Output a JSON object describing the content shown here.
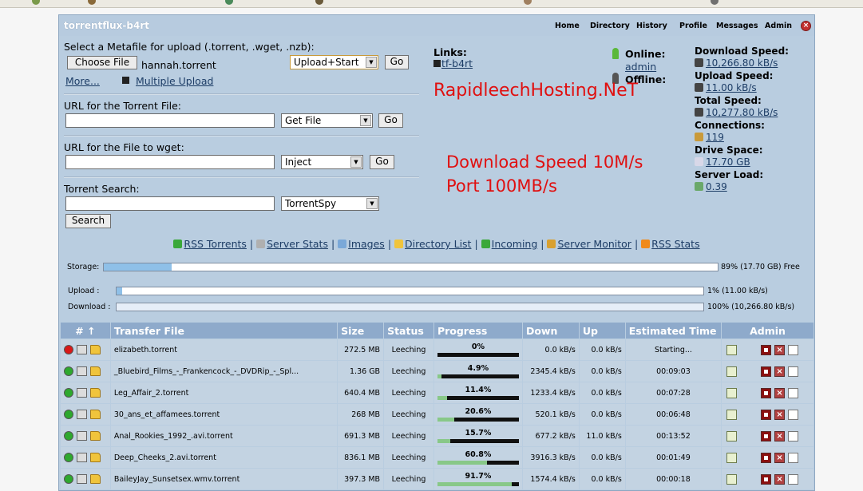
{
  "app": {
    "title": "torrentflux-b4rt"
  },
  "nav": [
    "Home",
    "Directory",
    "History",
    "Profile",
    "Messages",
    "Admin"
  ],
  "upload": {
    "label": "Select a Metafile for upload (.torrent, .wget, .nzb):",
    "choose_button": "Choose File",
    "file_name": "hannah.torrent",
    "action_select": "Upload+Start",
    "go": "Go",
    "more": "More...",
    "multiple": "Multiple Upload"
  },
  "torrent_url": {
    "label": "URL for the Torrent File:",
    "select": "Get File",
    "go": "Go"
  },
  "wget_url": {
    "label": "URL for the File to wget:",
    "select": "Inject",
    "go": "Go"
  },
  "search": {
    "label": "Torrent Search:",
    "select": "TorrentSpy",
    "button": "Search"
  },
  "links": {
    "label": "Links:",
    "item": "tf-b4rt"
  },
  "users": {
    "online_label": "Online:",
    "online_user": "admin",
    "offline_label": "Offline:"
  },
  "promo": {
    "line1": "RapidleechHosting.NeT",
    "line2": "Download Speed 10M/s",
    "line3": "Port 100MB/s"
  },
  "stats": {
    "download_label": "Download Speed:",
    "download_value": "10,266.80 kB/s",
    "upload_label": "Upload Speed:",
    "upload_value": "11.00 kB/s",
    "total_label": "Total Speed:",
    "total_value": "10,277.80 kB/s",
    "connections_label": "Connections:",
    "connections_value": "119",
    "drive_label": "Drive Space:",
    "drive_value": "17.70 GB",
    "load_label": "Server Load:",
    "load_value": "0.39"
  },
  "linkbar": [
    "RSS Torrents",
    "Server Stats",
    "Images",
    "Directory List",
    "Incoming",
    "Server Monitor",
    "RSS Stats"
  ],
  "linkbar_sep": "|",
  "bars": {
    "storage_label": "Storage:",
    "storage_pct": 89,
    "storage_text": "89% (17.70 GB) Free",
    "upload_label": "Upload :",
    "upload_pct": 1,
    "upload_text": "1% (11.00 kB/s)",
    "download_label": "Download :",
    "download_pct": 100,
    "download_text": "100% (10,266.80 kB/s)"
  },
  "table": {
    "headers": [
      "# ↑",
      "Transfer File",
      "Size",
      "Status",
      "Progress",
      "Down",
      "Up",
      "Estimated Time",
      "Admin"
    ],
    "rows": [
      {
        "state": "red",
        "file": "elizabeth.torrent",
        "size": "272.5 MB",
        "status": "Leeching",
        "progress": "0%",
        "pct": 0,
        "down": "0.0 kB/s",
        "up": "0.0 kB/s",
        "eta": "Starting..."
      },
      {
        "state": "green",
        "file": "_Bluebird_Films_-_Frankencock_-_DVDRip_-_Spl...",
        "size": "1.36 GB",
        "status": "Leeching",
        "progress": "4.9%",
        "pct": 4.9,
        "down": "2345.4 kB/s",
        "up": "0.0 kB/s",
        "eta": "00:09:03"
      },
      {
        "state": "green",
        "file": "Leg_Affair_2.torrent",
        "size": "640.4 MB",
        "status": "Leeching",
        "progress": "11.4%",
        "pct": 11.4,
        "down": "1233.4 kB/s",
        "up": "0.0 kB/s",
        "eta": "00:07:28"
      },
      {
        "state": "green",
        "file": "30_ans_et_affamees.torrent",
        "size": "268 MB",
        "status": "Leeching",
        "progress": "20.6%",
        "pct": 20.6,
        "down": "520.1 kB/s",
        "up": "0.0 kB/s",
        "eta": "00:06:48"
      },
      {
        "state": "green",
        "file": "Anal_Rookies_1992_.avi.torrent",
        "size": "691.3 MB",
        "status": "Leeching",
        "progress": "15.7%",
        "pct": 15.7,
        "down": "677.2 kB/s",
        "up": "11.0 kB/s",
        "eta": "00:13:52"
      },
      {
        "state": "green",
        "file": "Deep_Cheeks_2.avi.torrent",
        "size": "836.1 MB",
        "status": "Leeching",
        "progress": "60.8%",
        "pct": 60.8,
        "down": "3916.3 kB/s",
        "up": "0.0 kB/s",
        "eta": "00:01:49"
      },
      {
        "state": "green",
        "file": "BaileyJay_Sunsetsex.wmv.torrent",
        "size": "397.3 MB",
        "status": "Leeching",
        "progress": "91.7%",
        "pct": 91.7,
        "down": "1574.4 kB/s",
        "up": "0.0 kB/s",
        "eta": "00:00:18"
      }
    ]
  },
  "colors": {
    "panel": "#b9cde0",
    "header": "#8eaacb",
    "row": "#c3d3e2",
    "promo": "#e01010",
    "link": "#1d3d66"
  }
}
